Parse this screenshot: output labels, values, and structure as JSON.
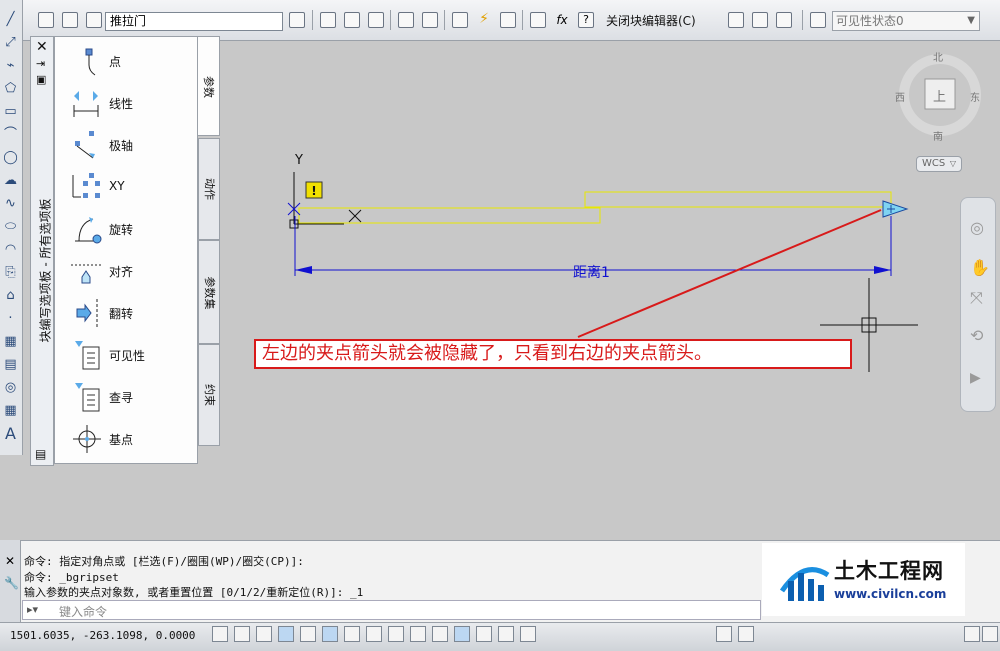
{
  "toolbar": {
    "block_name": "推拉门",
    "close_editor_label": "关闭块编辑器(C)",
    "visibility_state": "可见性状态0"
  },
  "palette": {
    "title": "块编写选项板 - 所有选项板",
    "items": [
      {
        "label": "点",
        "icon": "point-parameter-icon"
      },
      {
        "label": "线性",
        "icon": "linear-parameter-icon"
      },
      {
        "label": "极轴",
        "icon": "polar-parameter-icon"
      },
      {
        "label": "XY",
        "icon": "xy-parameter-icon"
      },
      {
        "label": "旋转",
        "icon": "rotation-parameter-icon"
      },
      {
        "label": "对齐",
        "icon": "alignment-parameter-icon"
      },
      {
        "label": "翻转",
        "icon": "flip-parameter-icon"
      },
      {
        "label": "可见性",
        "icon": "visibility-parameter-icon"
      },
      {
        "label": "查寻",
        "icon": "lookup-parameter-icon"
      },
      {
        "label": "基点",
        "icon": "basepoint-parameter-icon"
      }
    ],
    "tabs": [
      "参数",
      "动作",
      "参数集",
      "约束"
    ]
  },
  "canvas": {
    "dimension_label": "距离1",
    "annotation": "左边的夹点箭头就会被隐藏了，只看到右边的夹点箭头。",
    "y_axis_label": "Y",
    "compass": {
      "north": "北",
      "south": "南",
      "east": "东",
      "west": "西",
      "top": "上"
    },
    "wcs_label": "WCS",
    "colors": {
      "annotation": "#d81a1a",
      "dimension": "#1010d0",
      "geometry": "#e8e800",
      "grip": "#7fd4f2"
    }
  },
  "command": {
    "history": [
      "命令: 指定对角点或 [栏选(F)/圈围(WP)/圈交(CP)]:",
      "命令: _bgripset",
      "输入参数的夹点对象数, 或者重置位置 [0/1/2/重新定位(R)]: _1"
    ],
    "placeholder": "键入命令"
  },
  "status": {
    "coordinates": "1501.6035, -263.1098, 0.0000"
  },
  "watermark": {
    "title": "土木工程网",
    "url": "www.civilcn.com"
  }
}
